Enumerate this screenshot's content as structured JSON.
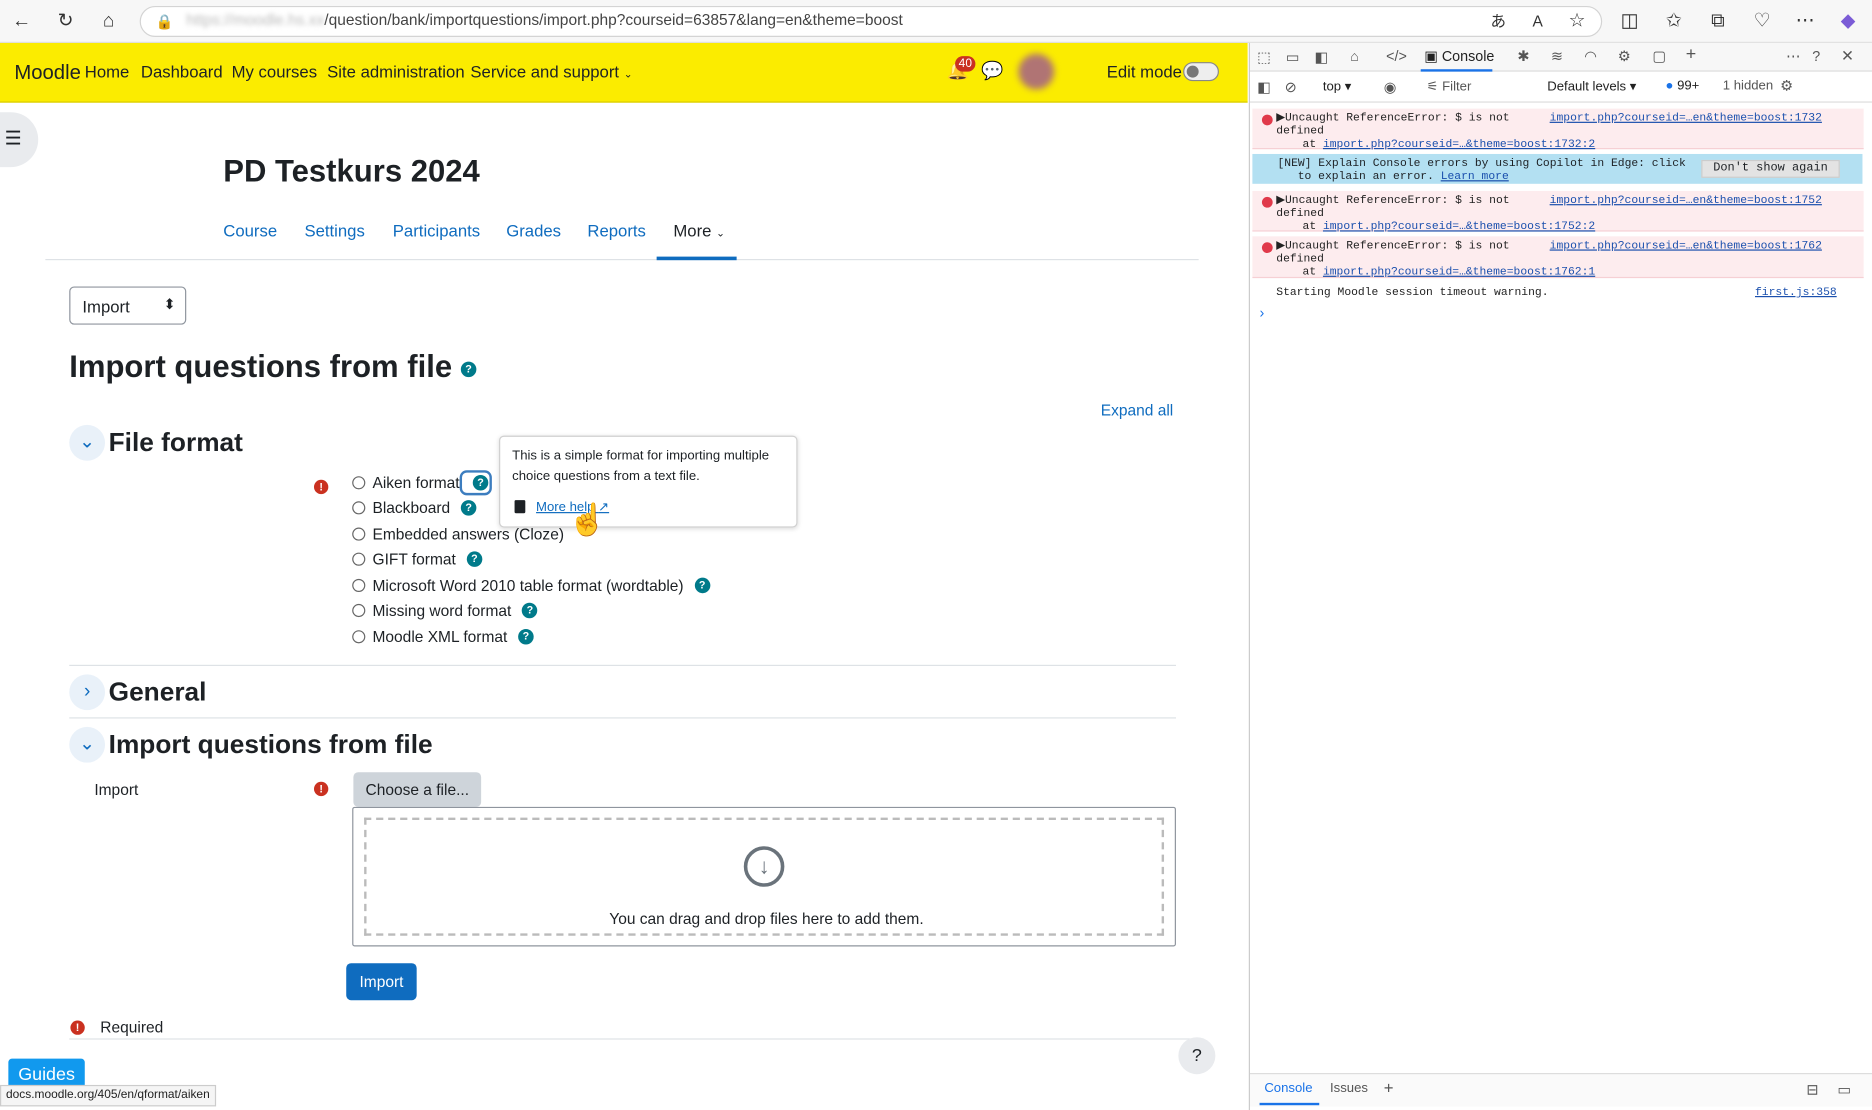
{
  "browser": {
    "url_blurred": "https://moodle.hs.xx",
    "url_path": "/question/bank/importquestions/import.php?courseid=63857&lang=en&theme=boost",
    "status_url": "docs.moodle.org/405/en/qformat/aiken"
  },
  "navbar": {
    "brand": "Moodle",
    "links": [
      "Home",
      "Dashboard",
      "My courses",
      "Site administration",
      "Service and support"
    ],
    "notifications_count": "40",
    "edit_mode_label": "Edit mode"
  },
  "course": {
    "title": "PD Testkurs 2024",
    "tabs": [
      "Course",
      "Settings",
      "Participants",
      "Grades",
      "Reports",
      "More"
    ]
  },
  "import_select": {
    "value": "Import"
  },
  "page_title": "Import questions from file",
  "expand_all": "Expand all",
  "sections": {
    "file_format": "File format",
    "general": "General",
    "import_from_file": "Import questions from file"
  },
  "formats": [
    "Aiken format",
    "Blackboard",
    "Embedded answers (Cloze)",
    "GIFT format",
    "Microsoft Word 2010 table format (wordtable)",
    "Missing word format",
    "Moodle XML format"
  ],
  "tooltip": {
    "text": "This is a simple format for importing multiple choice questions from a text file.",
    "more_help": "More help"
  },
  "import_field": {
    "label": "Import",
    "choose_button": "Choose a file...",
    "drop_text": "You can drag and drop files here to add them.",
    "submit": "Import"
  },
  "required_label": "Required",
  "guides": "Guides",
  "devtools": {
    "tab": "Console",
    "context": "top",
    "filter_placeholder": "Filter",
    "levels": "Default levels",
    "count": "99+",
    "hidden": "1 hidden",
    "messages": [
      {
        "line1": "▶Uncaught ReferenceError: $ is not",
        "line2": "defined",
        "line3": "at ",
        "link": "import.php?courseid=…&theme=boost:1732:2",
        "source": "import.php?courseid=…en&theme=boost:1732"
      },
      {
        "line1": "▶Uncaught ReferenceError: $ is not",
        "line2": "defined",
        "line3": "at ",
        "link": "import.php?courseid=…&theme=boost:1752:2",
        "source": "import.php?courseid=…en&theme=boost:1752"
      },
      {
        "line1": "▶Uncaught ReferenceError: $ is not",
        "line2": "defined",
        "line3": "at ",
        "link": "import.php?courseid=…&theme=boost:1762:1",
        "source": "import.php?courseid=…en&theme=boost:1762"
      }
    ],
    "copilot_line1": "[NEW] Explain Console errors by using Copilot in Edge: click",
    "copilot_line2": "to explain an error.",
    "learn_more": "Learn more",
    "dont_show": "Don't show again",
    "info_msg": "Starting Moodle session timeout warning.",
    "info_source": "first.js:358",
    "bottom_tabs": [
      "Console",
      "Issues"
    ]
  }
}
